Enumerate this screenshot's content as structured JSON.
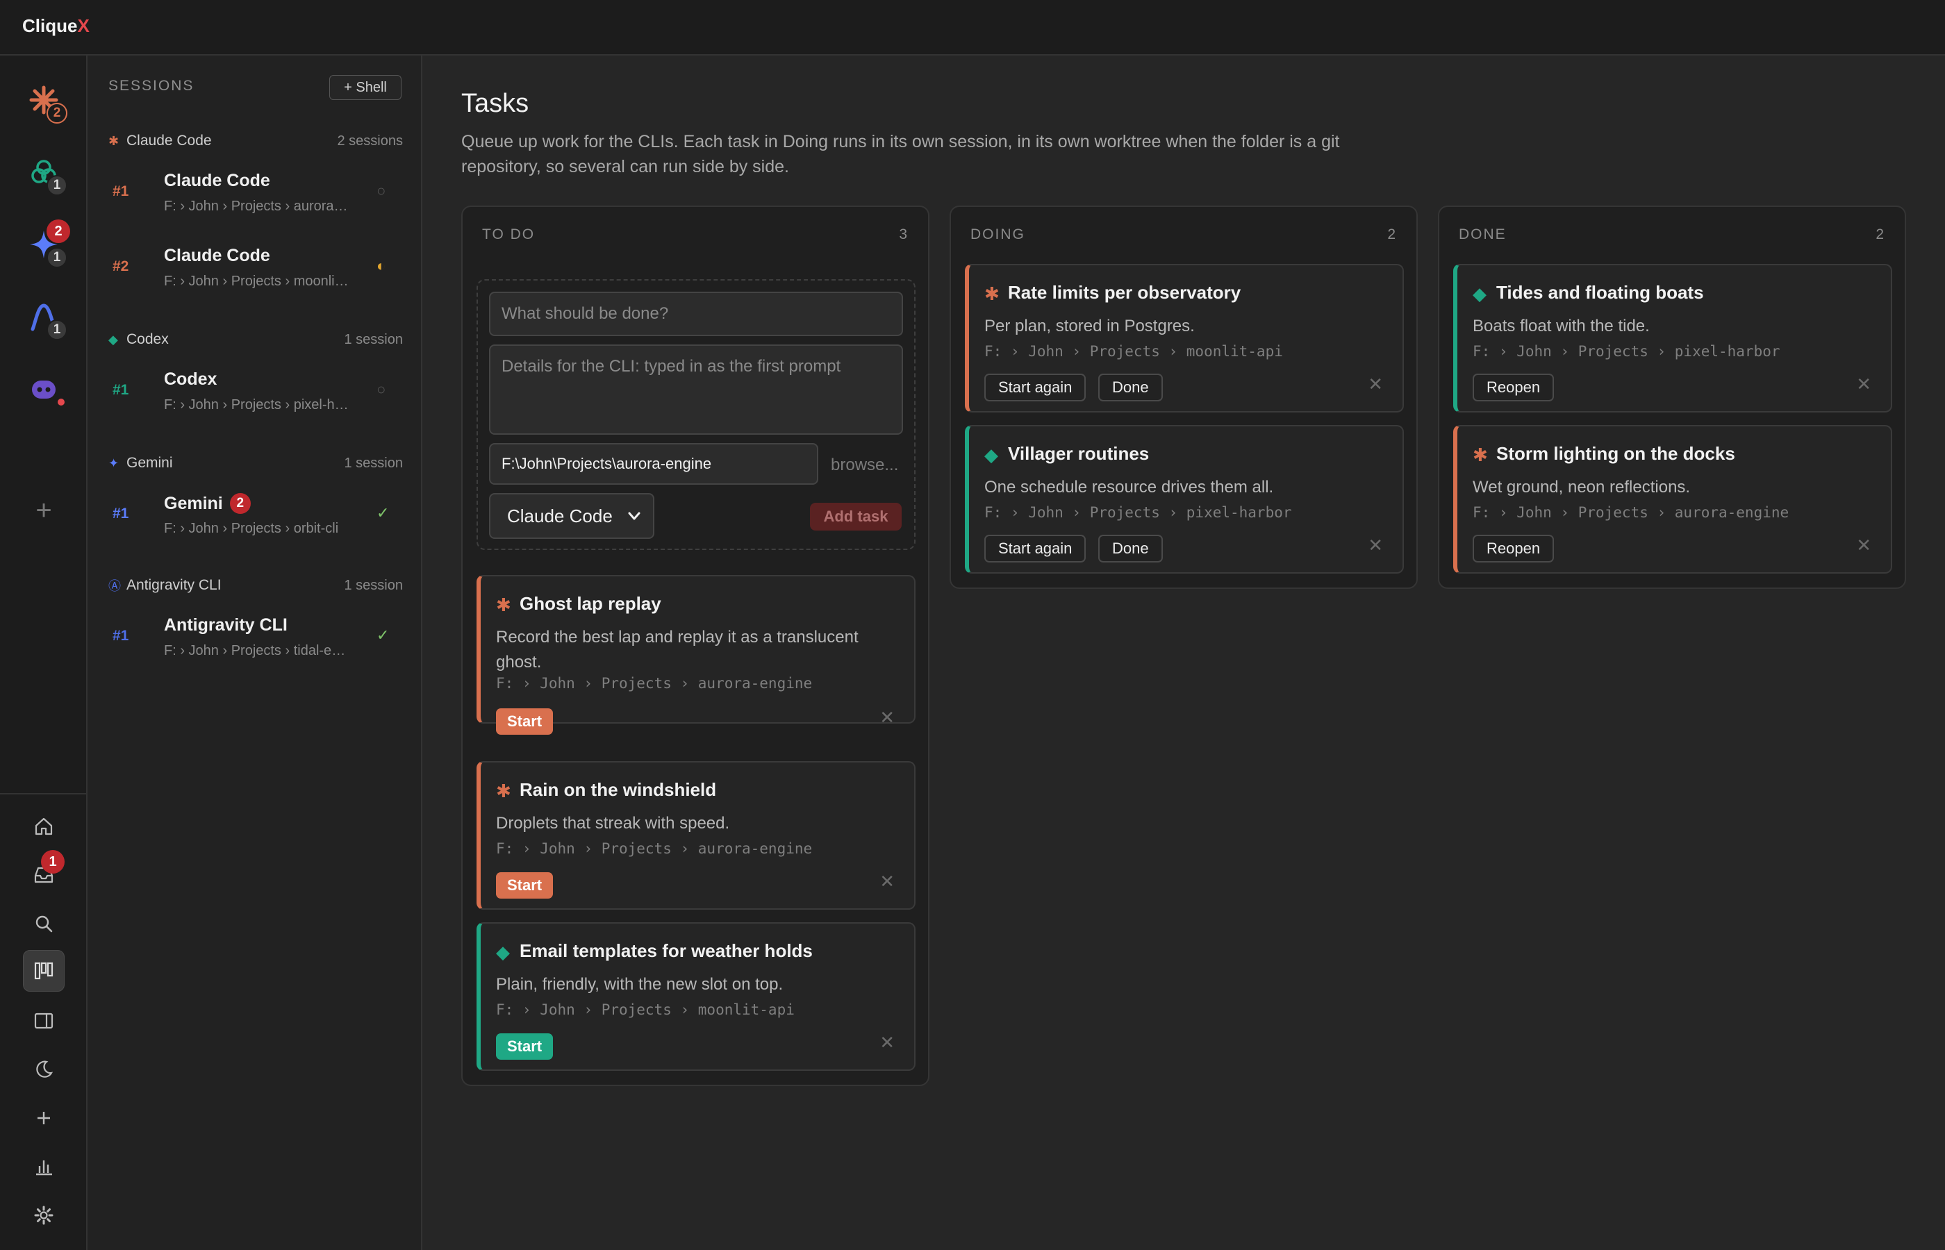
{
  "app": {
    "name_prefix": "Clique",
    "name_suffix": "X"
  },
  "rail": {
    "agents": [
      {
        "name": "Claude Code",
        "count": "2"
      },
      {
        "name": "Codex",
        "count": "1"
      },
      {
        "name": "Gemini",
        "count": "1",
        "alert": "2"
      },
      {
        "name": "Antigravity CLI",
        "count": "1"
      },
      {
        "name": "Copilot"
      }
    ],
    "inbox_alert": "1"
  },
  "sessions": {
    "title": "SESSIONS",
    "shell_button": "+ Shell",
    "groups": [
      {
        "name": "Claude Code",
        "count": "2 sessions",
        "color": "#d9704e",
        "items": [
          {
            "num": "#1",
            "title": "Claude Code",
            "path": "F: › John › Projects › aurora-engine",
            "status": "idle"
          },
          {
            "num": "#2",
            "title": "Claude Code",
            "path": "F: › John › Projects › moonlit-api",
            "status": "half"
          }
        ]
      },
      {
        "name": "Codex",
        "count": "1 session",
        "color": "#1fa885",
        "items": [
          {
            "num": "#1",
            "title": "Codex",
            "path": "F: › John › Projects › pixel-harbor",
            "status": "idle"
          }
        ]
      },
      {
        "name": "Gemini",
        "count": "1 session",
        "color": "#5b7cfa",
        "items": [
          {
            "num": "#1",
            "title": "Gemini",
            "badge": "2",
            "path": "F: › John › Projects › orbit-cli",
            "status": "done"
          }
        ]
      },
      {
        "name": "Antigravity CLI",
        "count": "1 session",
        "color": "#4f6fe8",
        "items": [
          {
            "num": "#1",
            "title": "Antigravity CLI",
            "path": "F: › John › Projects › tidal-engine",
            "status": "done"
          }
        ]
      }
    ]
  },
  "main": {
    "title": "Tasks",
    "description": "Queue up work for the CLIs. Each task in Doing runs in its own session, in its own worktree when the folder is a git repository, so several can run side by side."
  },
  "columns": {
    "todo": {
      "label": "TO DO",
      "count": "3",
      "form": {
        "title_placeholder": "What should be done?",
        "details_placeholder": "Details for the CLI: typed in as the first prompt",
        "folder_value": "F:\\John\\Projects\\aurora-engine",
        "browse": "browse...",
        "cli_selected": "Claude Code",
        "add_button": "Add task"
      },
      "cards": [
        {
          "cli": "claude",
          "title": "Ghost lap replay",
          "desc": "Record the best lap and replay it as a translucent ghost.",
          "path": "F: › John › Projects › aurora-engine",
          "action": "Start"
        },
        {
          "cli": "claude",
          "title": "Rain on the windshield",
          "desc": "Droplets that streak with speed.",
          "path": "F: › John › Projects › aurora-engine",
          "action": "Start"
        },
        {
          "cli": "codex",
          "title": "Email templates for weather holds",
          "desc": "Plain, friendly, with the new slot on top.",
          "path": "F: › John › Projects › moonlit-api",
          "action": "Start"
        }
      ]
    },
    "doing": {
      "label": "DOING",
      "count": "2",
      "cards": [
        {
          "cli": "claude",
          "title": "Rate limits per observatory",
          "desc": "Per plan, stored in Postgres.",
          "path": "F: › John › Projects › moonlit-api",
          "action1": "Start again",
          "action2": "Done"
        },
        {
          "cli": "codex",
          "title": "Villager routines",
          "desc": "One schedule resource drives them all.",
          "path": "F: › John › Projects › pixel-harbor",
          "action1": "Start again",
          "action2": "Done"
        }
      ]
    },
    "done": {
      "label": "DONE",
      "count": "2",
      "cards": [
        {
          "cli": "codex",
          "title": "Tides and floating boats",
          "desc": "Boats float with the tide.",
          "path": "F: › John › Projects › pixel-harbor",
          "action": "Reopen"
        },
        {
          "cli": "claude",
          "title": "Storm lighting on the docks",
          "desc": "Wet ground, neon reflections.",
          "path": "F: › John › Projects › aurora-engine",
          "action": "Reopen"
        }
      ]
    }
  },
  "colors": {
    "claude": "#d9704e",
    "codex": "#1fa885",
    "gemini": "#5b7cfa",
    "alert": "#c0282d"
  }
}
